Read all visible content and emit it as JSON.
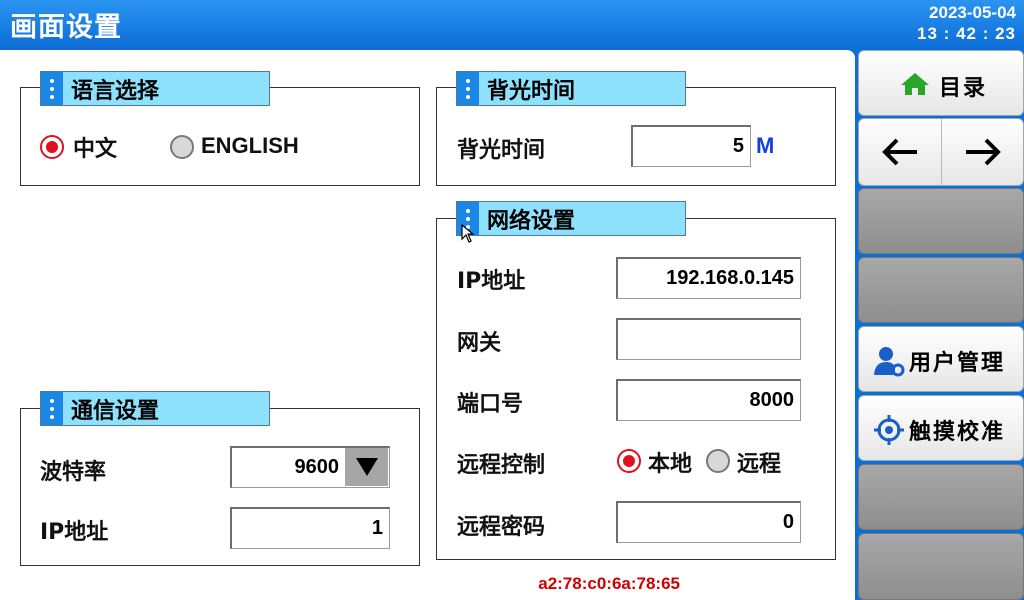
{
  "header": {
    "title": "画面设置",
    "date": "2023-05-04",
    "time": "13 : 42 : 23"
  },
  "language": {
    "title": "语言选择",
    "options": [
      {
        "label": "中文",
        "selected": true
      },
      {
        "label": "ENGLISH",
        "selected": false
      }
    ]
  },
  "backlight": {
    "title": "背光时间",
    "label": "背光时间",
    "value": "5",
    "unit": "M"
  },
  "network": {
    "title": "网络设置",
    "ip_label": "IP地址",
    "ip_value": "192.168.0.145",
    "gateway_label": "网关",
    "gateway_value": "",
    "port_label": "端口号",
    "port_value": "8000",
    "remote_label": "远程控制",
    "remote_options": [
      {
        "label": "本地",
        "selected": true
      },
      {
        "label": "远程",
        "selected": false
      }
    ],
    "password_label": "远程密码",
    "password_value": "0"
  },
  "comm": {
    "title": "通信设置",
    "baud_label": "波特率",
    "baud_value": "9600",
    "ip_label": "IP地址",
    "ip_value": "1"
  },
  "side": {
    "menu_label": "目录",
    "user_label": "用户管理",
    "touch_label": "触摸校准"
  },
  "footer": {
    "mac": "a2:78:c0:6a:78:65"
  },
  "colors": {
    "accent": "#0e6fd8",
    "header_tab": "#8ee1fc",
    "selected": "#e0101e",
    "unit": "#1040e0"
  },
  "icons": [
    "home-icon",
    "arrow-left-icon",
    "arrow-right-icon",
    "user-settings-icon",
    "crosshair-icon",
    "dropdown-arrow-icon",
    "mouse-cursor-icon"
  ]
}
